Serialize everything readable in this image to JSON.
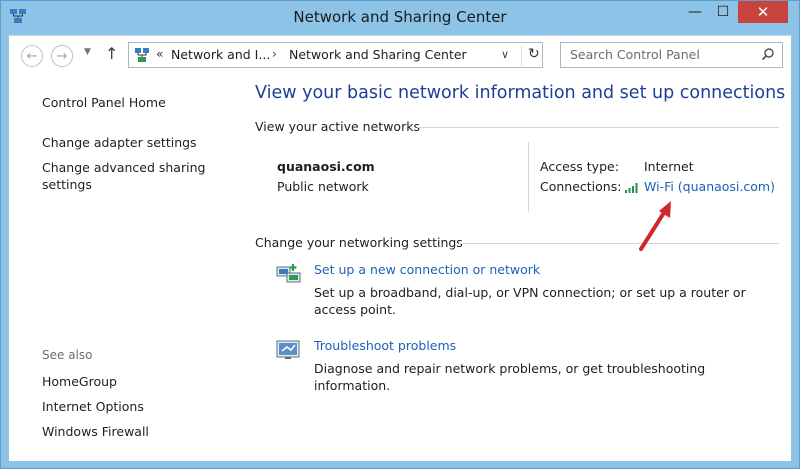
{
  "window": {
    "title": "Network and Sharing Center"
  },
  "navbar": {
    "address": {
      "chevron": "«",
      "crumb1": "Network and I...",
      "separator": "›",
      "crumb2": "Network and Sharing Center"
    },
    "search": {
      "placeholder": "Search Control Panel"
    }
  },
  "sidebar": {
    "home": "Control Panel Home",
    "links": [
      "Change adapter settings",
      "Change advanced sharing",
      "settings"
    ],
    "see_also_heading": "See also",
    "see_also": [
      "HomeGroup",
      "Internet Options",
      "Windows Firewall"
    ]
  },
  "main": {
    "title": "View your basic network information and set up connections",
    "active_heading": "View your active networks",
    "network": {
      "name": "quanaosi.com",
      "type": "Public network",
      "access_label": "Access type:",
      "access_value": "Internet",
      "connections_label": "Connections:",
      "connection_link": "Wi-Fi (quanaosi.com)"
    },
    "change_heading": "Change your networking settings",
    "tasks": [
      {
        "link": "Set up a new connection or network",
        "desc": "Set up a broadband, dial-up, or VPN connection; or set up a router or access point."
      },
      {
        "link": "Troubleshoot problems",
        "desc": "Diagnose and repair network problems, or get troubleshooting information."
      }
    ]
  },
  "colors": {
    "link": "#1d62b7",
    "title": "#1e3f99",
    "close": "#c7433b",
    "arrow": "#d1272b"
  },
  "icons": [
    "network-app-icon",
    "back-arrow-icon",
    "forward-arrow-icon",
    "up-arrow-icon",
    "control-panel-icon",
    "refresh-icon",
    "search-icon",
    "wifi-signal-icon",
    "new-connection-icon",
    "troubleshoot-icon"
  ]
}
